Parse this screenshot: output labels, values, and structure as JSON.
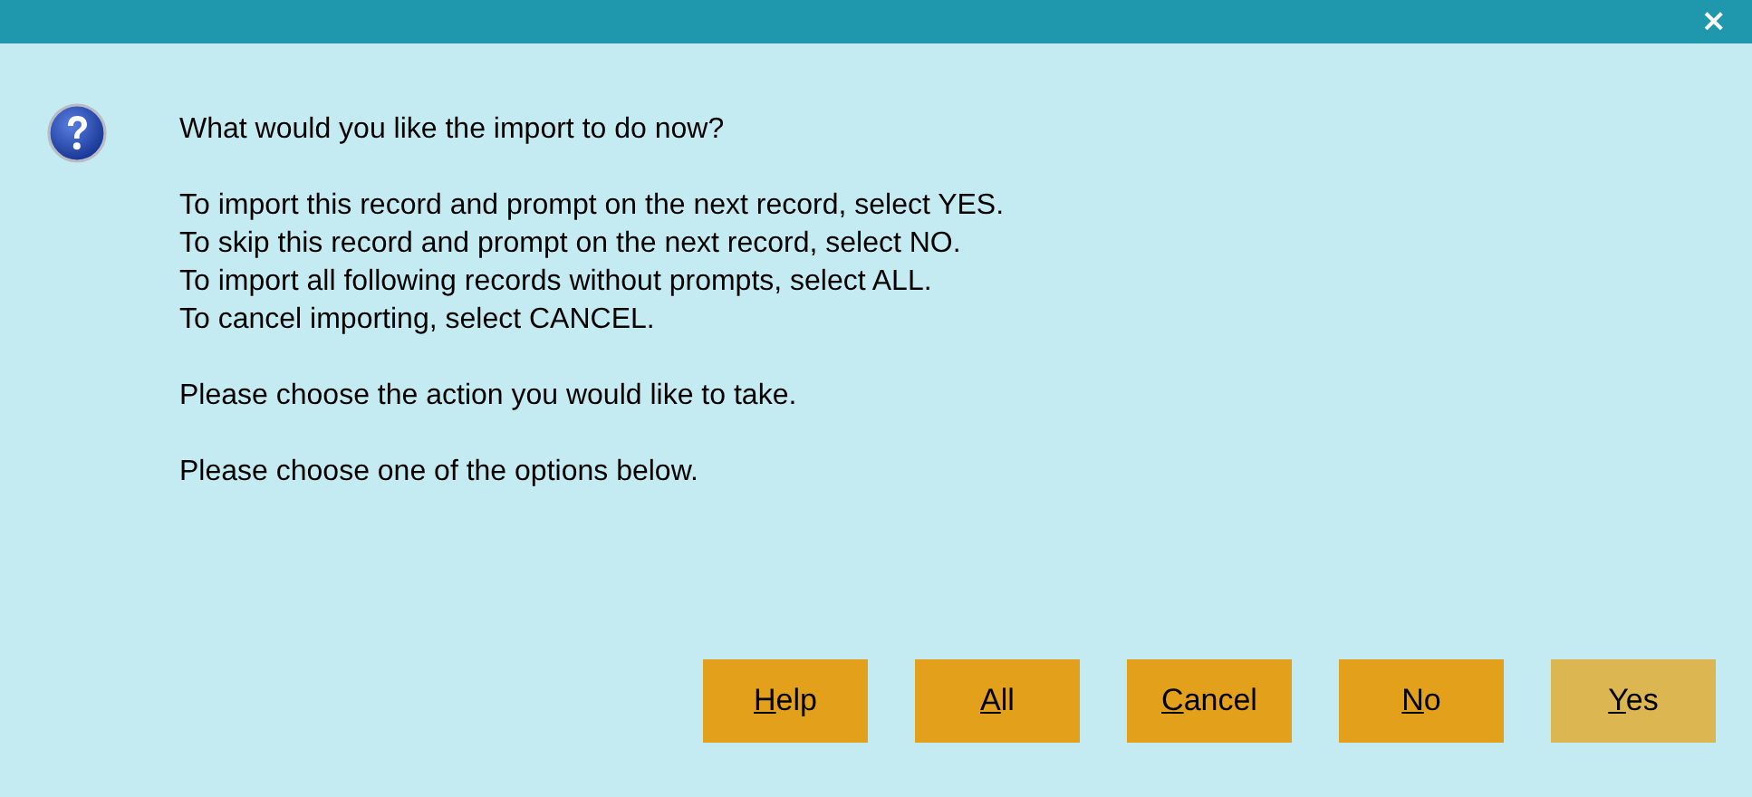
{
  "title_bar": {
    "close": "×"
  },
  "message": {
    "paragraphs": [
      [
        "What would you like the import to do now?"
      ],
      [
        "To import this record and prompt on the next record, select YES.",
        "To skip this record and prompt on the next record, select NO.",
        "To import all following records without prompts, select ALL.",
        "To cancel importing, select CANCEL."
      ],
      [
        "Please choose the action you would like to take."
      ],
      [
        "Please choose one of the options below."
      ]
    ]
  },
  "buttons": [
    {
      "mnemonic": "H",
      "rest": "elp",
      "highlighted": false
    },
    {
      "mnemonic": "A",
      "rest": "ll",
      "highlighted": false
    },
    {
      "mnemonic": "C",
      "rest": "ancel",
      "highlighted": false
    },
    {
      "mnemonic": "N",
      "rest": "o",
      "highlighted": false
    },
    {
      "mnemonic": "Y",
      "rest": "es",
      "highlighted": true
    }
  ]
}
